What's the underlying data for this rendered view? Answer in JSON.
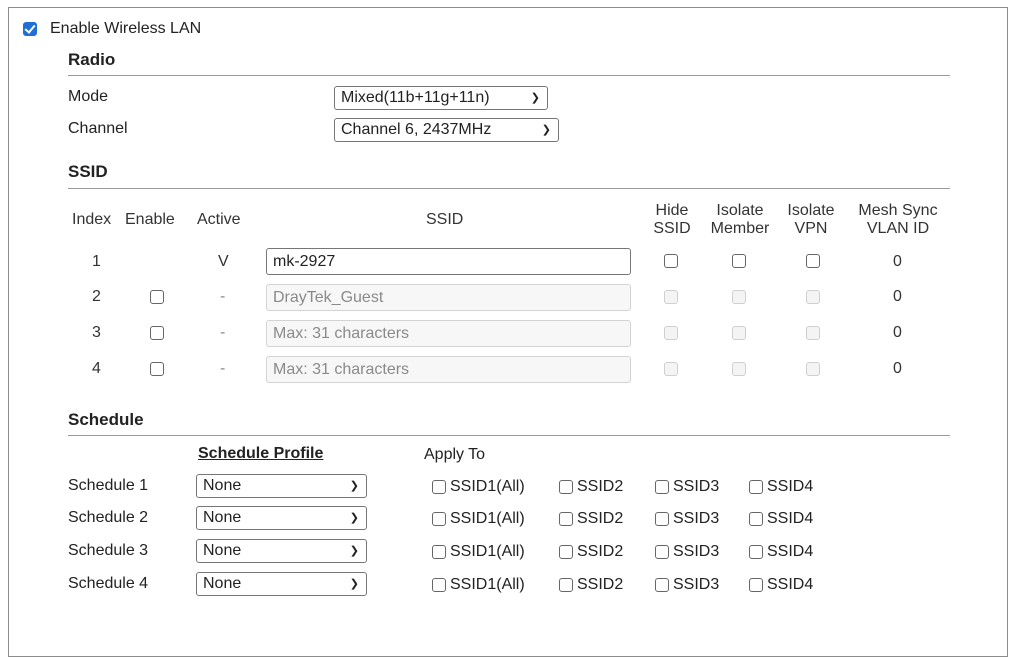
{
  "wlan": {
    "enable_label": "Enable Wireless LAN",
    "enabled": true
  },
  "radio": {
    "title": "Radio",
    "mode_label": "Mode",
    "mode_value": "Mixed(11b+11g+11n)",
    "channel_label": "Channel",
    "channel_value": "Channel 6, 2437MHz"
  },
  "ssid": {
    "title": "SSID",
    "headers": {
      "index": "Index",
      "enable": "Enable",
      "active": "Active",
      "ssid": "SSID",
      "hide": [
        "Hide",
        "SSID"
      ],
      "isolate_member": [
        "Isolate",
        "Member"
      ],
      "isolate_vpn": [
        "Isolate",
        "VPN"
      ],
      "mesh_sync": [
        "Mesh Sync",
        "VLAN ID"
      ]
    },
    "rows": [
      {
        "index": "1",
        "active": "V",
        "value": "mk-2927",
        "placeholder": "",
        "vlan": "0"
      },
      {
        "index": "2",
        "active": "-",
        "value": "DrayTek_Guest",
        "placeholder": "",
        "vlan": "0"
      },
      {
        "index": "3",
        "active": "-",
        "value": "",
        "placeholder": "Max: 31 characters",
        "vlan": "0"
      },
      {
        "index": "4",
        "active": "-",
        "value": "",
        "placeholder": "Max: 31 characters",
        "vlan": "0"
      }
    ]
  },
  "schedule": {
    "title": "Schedule",
    "profile_header": "Schedule Profile",
    "apply_header": "Apply To",
    "rows": [
      {
        "label": "Schedule 1",
        "profile": "None"
      },
      {
        "label": "Schedule 2",
        "profile": "None"
      },
      {
        "label": "Schedule 3",
        "profile": "None"
      },
      {
        "label": "Schedule 4",
        "profile": "None"
      }
    ],
    "apply_options": [
      "SSID1(All)",
      "SSID2",
      "SSID3",
      "SSID4"
    ]
  },
  "icons": {
    "checkbox": "checkbox-icon",
    "dropdown": "chevron-down-icon"
  },
  "colors": {
    "accent": "#1f6fd6"
  }
}
